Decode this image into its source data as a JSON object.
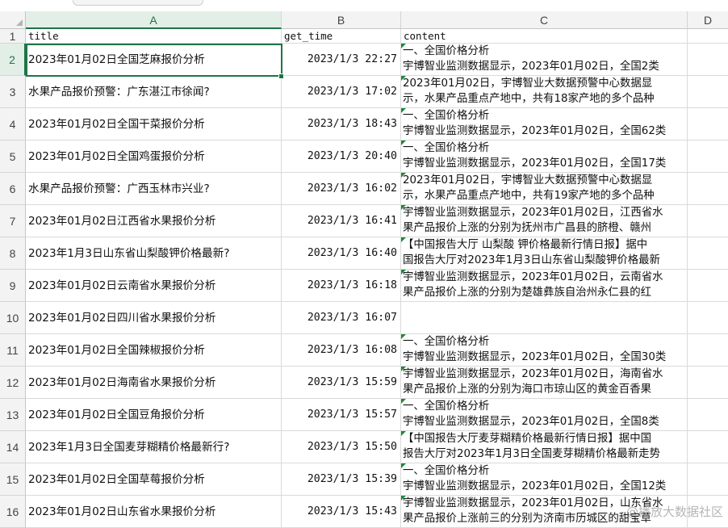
{
  "columns": [
    "A",
    "B",
    "C",
    "D"
  ],
  "header_row": {
    "row_number": "1",
    "title": "title",
    "get_time": "get_time",
    "content": "content"
  },
  "rows": [
    {
      "num": "2",
      "title": "2023年01月02日全国芝麻报价分析",
      "time": "2023/1/3 22:27",
      "content": [
        "一、全国价格分析",
        "宇博智业监测数据显示，2023年01月02日，全国2类"
      ]
    },
    {
      "num": "3",
      "title": "水果产品报价预警：广东湛江市徐闻?",
      "time": "2023/1/3 17:02",
      "content": [
        "2023年01月02日，宇博智业大数据预警中心数据显",
        "示，水果产品重点产地中，共有18家产地的多个品种"
      ]
    },
    {
      "num": "4",
      "title": "2023年01月02日全国干菜报价分析",
      "time": "2023/1/3 18:43",
      "content": [
        "一、全国价格分析",
        "宇博智业监测数据显示，2023年01月02日，全国62类"
      ]
    },
    {
      "num": "5",
      "title": "2023年01月02日全国鸡蛋报价分析",
      "time": "2023/1/3 20:40",
      "content": [
        "一、全国价格分析",
        "宇博智业监测数据显示，2023年01月02日，全国17类"
      ]
    },
    {
      "num": "6",
      "title": "水果产品报价预警：广西玉林市兴业?",
      "time": "2023/1/3 16:02",
      "content": [
        "2023年01月02日，宇博智业大数据预警中心数据显",
        "示，水果产品重点产地中，共有19家产地的多个品种"
      ]
    },
    {
      "num": "7",
      "title": "2023年01月02日江西省水果报价分析",
      "time": "2023/1/3 16:41",
      "content": [
        "宇博智业监测数据显示，2023年01月02日，江西省水",
        "果产品报价上涨的分别为抚州市广昌县的脐橙、赣州"
      ]
    },
    {
      "num": "8",
      "title": "2023年1月3日山东省山梨酸钾价格最新?",
      "time": "2023/1/3 16:40",
      "content": [
        "【中国报告大厅 山梨酸 钾价格最新行情日报】据中",
        "国报告大厅对2023年1月3日山东省山梨酸钾价格最新"
      ]
    },
    {
      "num": "9",
      "title": "2023年01月02日云南省水果报价分析",
      "time": "2023/1/3 16:18",
      "content": [
        "宇博智业监测数据显示，2023年01月02日，云南省水",
        "果产品报价上涨的分别为楚雄彝族自治州永仁县的红"
      ]
    },
    {
      "num": "10",
      "title": "2023年01月02日四川省水果报价分析",
      "time": "2023/1/3 16:07",
      "content": []
    },
    {
      "num": "11",
      "title": "2023年01月02日全国辣椒报价分析",
      "time": "2023/1/3 16:08",
      "content": [
        "一、全国价格分析",
        "宇博智业监测数据显示，2023年01月02日，全国30类"
      ]
    },
    {
      "num": "12",
      "title": "2023年01月02日海南省水果报价分析",
      "time": "2023/1/3 15:59",
      "content": [
        "宇博智业监测数据显示，2023年01月02日，海南省水",
        "果产品报价上涨的分别为海口市琼山区的黄金百香果"
      ]
    },
    {
      "num": "13",
      "title": "2023年01月02日全国豆角报价分析",
      "time": "2023/1/3 15:57",
      "content": [
        "一、全国价格分析",
        "宇博智业监测数据显示，2023年01月02日，全国8类"
      ]
    },
    {
      "num": "14",
      "title": "2023年1月3日全国麦芽糊精价格最新行?",
      "time": "2023/1/3 15:50",
      "content": [
        "【中国报告大厅麦芽糊精价格最新行情日报】据中国",
        "报告大厅对2023年1月3日全国麦芽糊精价格最新走势"
      ]
    },
    {
      "num": "15",
      "title": "2023年01月02日全国草莓报价分析",
      "time": "2023/1/3 15:39",
      "content": [
        "一、全国价格分析",
        "宇博智业监测数据显示，2023年01月02日，全国12类"
      ]
    },
    {
      "num": "16",
      "title": "2023年01月02日山东省水果报价分析",
      "time": "2023/1/3 15:43",
      "content": [
        "宇博智业监测数据显示，2023年01月02日，山东省水",
        "果产品报价上涨前三的分别为济南市历城区的甜宝草"
      ]
    }
  ],
  "watermark": "@播放大数据社区",
  "colors": {
    "accent": "#217346",
    "indicator": "#1a8a3a",
    "grid": "#dadada",
    "header_bg": "#f3f3f3"
  }
}
